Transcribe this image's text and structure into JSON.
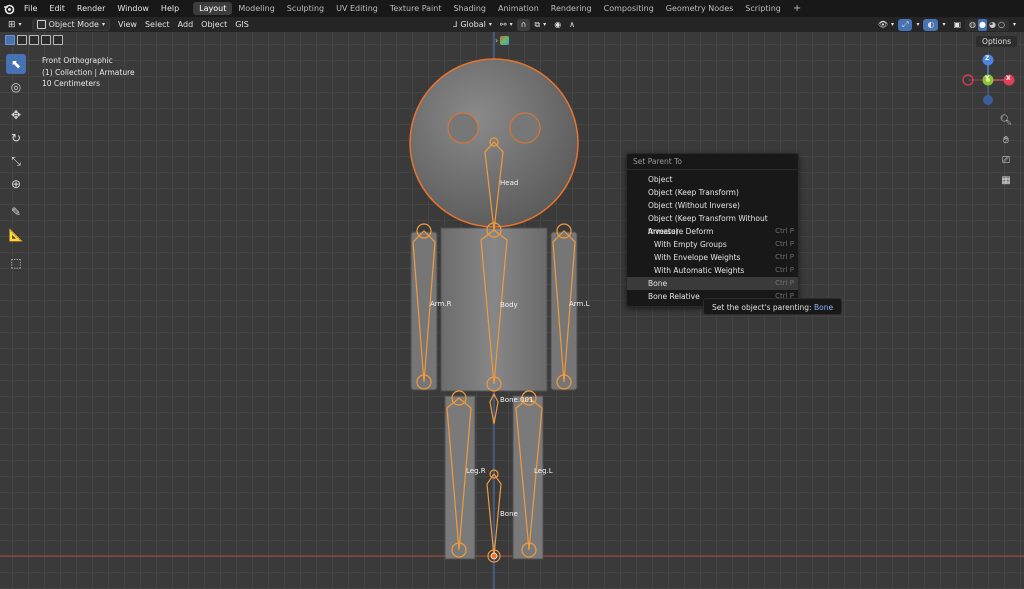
{
  "menubar": {
    "items": [
      "File",
      "Edit",
      "Render",
      "Window",
      "Help"
    ],
    "workspaces": [
      "Layout",
      "Modeling",
      "Sculpting",
      "UV Editing",
      "Texture Paint",
      "Shading",
      "Animation",
      "Rendering",
      "Compositing",
      "Geometry Nodes",
      "Scripting"
    ],
    "active_workspace": "Layout",
    "add_tab": "+"
  },
  "header": {
    "mode": "Object Mode",
    "menus": [
      "View",
      "Select",
      "Add",
      "Object",
      "GIS"
    ],
    "orientation": "Global"
  },
  "viewport": {
    "view_name": "Front Orthographic",
    "collection": "(1) Collection | Armature",
    "scale": "10 Centimeters",
    "options": "Options"
  },
  "bones": {
    "head": "Head",
    "arm_r": "Arm.R",
    "body": "Body",
    "arm_l": "Arm.L",
    "bone001": "Bone.001",
    "leg_r": "Leg.R",
    "leg_l": "Leg.L",
    "bone": "Bone"
  },
  "gizmo": {
    "z": "Z",
    "y": "Y",
    "x": "X"
  },
  "context_menu": {
    "title": "Set Parent To",
    "items": [
      {
        "label": "Object",
        "shortcut": ""
      },
      {
        "label": "Object (Keep Transform)",
        "shortcut": ""
      },
      {
        "label": "Object (Without Inverse)",
        "shortcut": ""
      },
      {
        "label": "Object (Keep Transform Without Inverse)",
        "shortcut": ""
      },
      {
        "label": "Armature Deform",
        "shortcut": "Ctrl P"
      },
      {
        "label": "With Empty Groups",
        "shortcut": "Ctrl P"
      },
      {
        "label": "With Envelope Weights",
        "shortcut": "Ctrl P"
      },
      {
        "label": "With Automatic Weights",
        "shortcut": "Ctrl P"
      },
      {
        "label": "Bone",
        "shortcut": "Ctrl P"
      },
      {
        "label": "Bone Relative",
        "shortcut": "Ctrl P"
      }
    ]
  },
  "tooltip": {
    "text": "Set the object's parenting:",
    "value": "Bone"
  },
  "colors": {
    "accent": "#4772b3",
    "selection_orange": "#e8742c",
    "bone_orange": "#f29a3c",
    "axis_x": "#e0405a",
    "axis_y": "#8bc43b",
    "axis_z": "#4d86e0"
  }
}
